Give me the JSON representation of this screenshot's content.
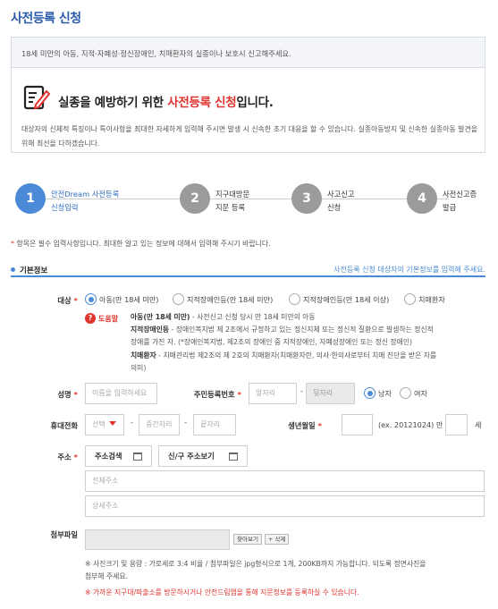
{
  "page": {
    "title": "사전등록 신청"
  },
  "notice": {
    "top_text": "18세 미만의 아동, 지적·자폐성·정신장애인, 치매환자의 실종이나 보호시 신고해주세요.",
    "title_prefix": "실종을 예방하기 위한 ",
    "title_highlight": "사전등록 신청",
    "title_suffix": "입니다.",
    "desc": "대상자의 신체적 특징이나 특이사항을 최대한 자세하게 입력해 주시면 발생 시 신속한 초기 대응을 할 수 있습니다. 실종아동방지 및 신속한 실종아동 발견을 위해 최선을 다하겠습니다."
  },
  "steps": [
    {
      "num": "1",
      "line1": "안전Dream 사전등록",
      "line2": "신청입력",
      "active": true
    },
    {
      "num": "2",
      "line1": "지구대방문",
      "line2": "지문 등록",
      "active": false
    },
    {
      "num": "3",
      "line1": "사고신고",
      "line2": "신청",
      "active": false
    },
    {
      "num": "4",
      "line1": "사전신고증",
      "line2": "발급",
      "active": false
    }
  ],
  "required_note": {
    "star": "*",
    "text": " 항목은 필수 입력사항입니다. 최대한 알고 있는 정보에 대해서 입력해 주시기 바랍니다."
  },
  "section": {
    "title": "기본정보",
    "hint": "사전등록 신청 대상자의 기본정보를 입력해 주세요."
  },
  "target": {
    "label": "대상",
    "options": [
      {
        "label": "아동(만 18세 미만)",
        "selected": true
      },
      {
        "label": "지적장애인등(만 18세 미만)",
        "selected": false
      },
      {
        "label": "지적장애인등(만 18세 이상)",
        "selected": false
      },
      {
        "label": "치매환자",
        "selected": false
      }
    ]
  },
  "help": {
    "badge": "?",
    "title": "도움말",
    "child_bold": "아동(만 18세 미만)",
    "child_text": " - 사전신고 신청 당시 만 18세 미만의 아동",
    "disabled_bold": "지적장애인등",
    "disabled_text1": " - 장애인복지법 제 2조에서 규정하고 있는 정신지체 또는 정신적 질환으로 발생하는 정신적",
    "disabled_text2": "장애를 가진 자. (*장애인복지법, 제2조의 장애인 중 지적장애인, 자폐성장애인 또는 정신 장애인)",
    "dementia_bold": "치매환자",
    "dementia_text1": " - 치매관리법 제2조의 제 2호의 치매환자(치매환자란, 의사·한의사로부터 치매 진단을 받은 자를",
    "dementia_text2": "의미)"
  },
  "name": {
    "label": "성명",
    "placeholder": "이름을 입력하세요"
  },
  "rrn": {
    "label": "주민등록번호",
    "front_placeholder": "앞자리",
    "back_placeholder": "뒷자리"
  },
  "gender": {
    "options": [
      {
        "label": "남자",
        "selected": true
      },
      {
        "label": "여자",
        "selected": false
      }
    ]
  },
  "phone": {
    "label": "휴대전화",
    "select_value": "선택",
    "mid_placeholder": "중간자리",
    "last_placeholder": "끝자리"
  },
  "birth": {
    "label": "생년월일",
    "example": "(ex. 20121024) 만",
    "unit": "세"
  },
  "address": {
    "label": "주소",
    "search_button": "주소검색",
    "new_old_button": "신/구 주소보기",
    "full_placeholder": "전체주소",
    "detail_placeholder": "상세주소"
  },
  "attach": {
    "label": "첨부파일",
    "find_button": "찾아보기",
    "delete_button": "+ 삭제"
  },
  "footnotes": {
    "photo1": "※ 사진크기 및 용량 : 가로세로 3:4 비율 / 첨부파일은 jpg형식으로 1개, 200KB까지 가능합니다. 되도록 정면사진을",
    "photo2": "첨부해 주세요.",
    "visit": "※ 가까운 지구대/파출소를 방문하시거나 안전드림앱을 통해 지문정보를 등록하실 수 있습니다."
  },
  "colors": {
    "accent": "#4a8ad6",
    "title": "#2a5bab",
    "required": "#e0342f",
    "step_inactive": "#9b9b9b"
  }
}
